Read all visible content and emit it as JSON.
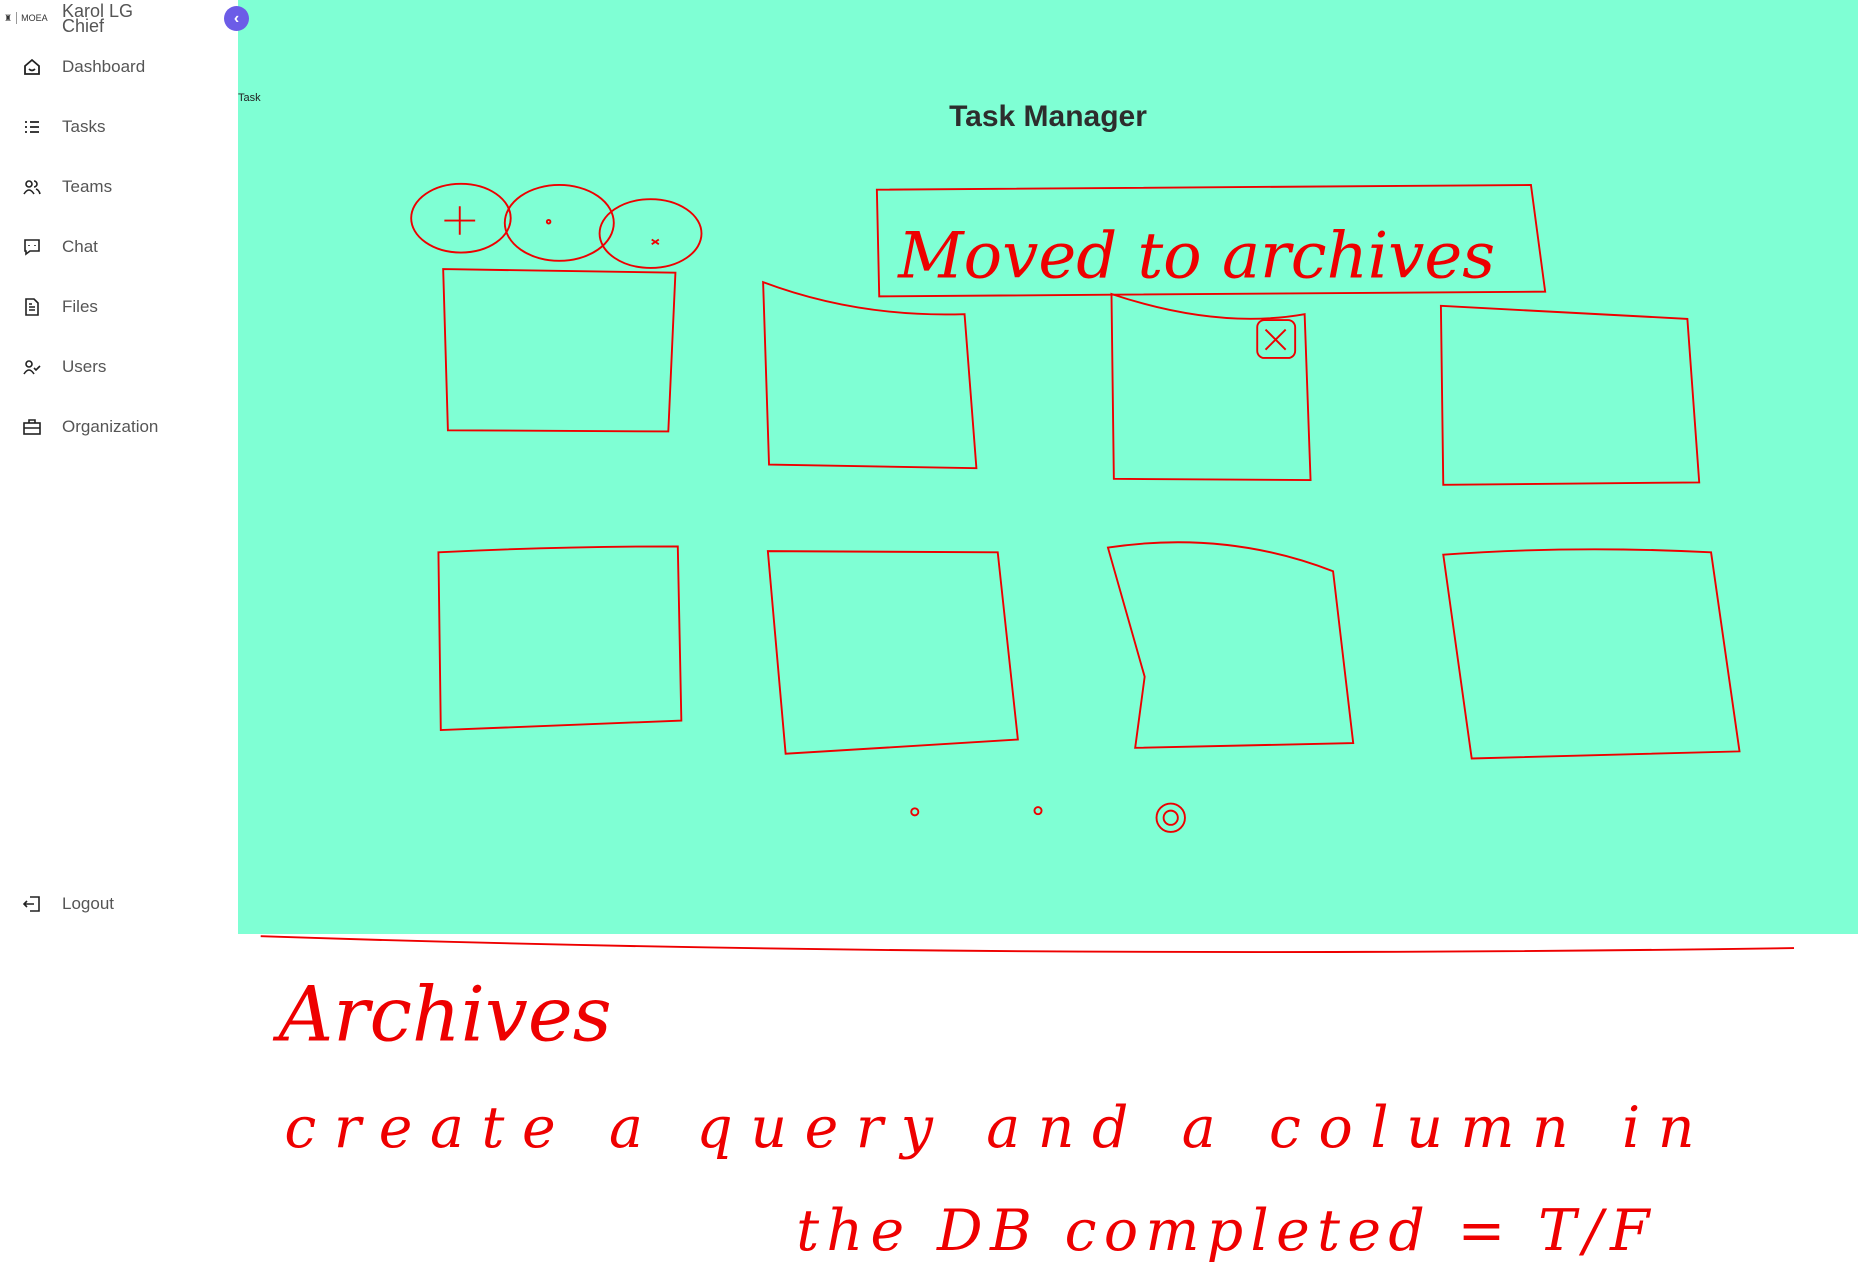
{
  "sidebar": {
    "brand": "MOEA",
    "user_name": "Karol LG",
    "user_role": "Chief",
    "collapse_icon": "chevron-left-icon",
    "items": [
      {
        "label": "Dashboard",
        "icon": "home-icon"
      },
      {
        "label": "Tasks",
        "icon": "list-icon"
      },
      {
        "label": "Teams",
        "icon": "users-icon"
      },
      {
        "label": "Chat",
        "icon": "chat-icon"
      },
      {
        "label": "Files",
        "icon": "file-icon"
      },
      {
        "label": "Users",
        "icon": "user-check-icon"
      },
      {
        "label": "Organization",
        "icon": "briefcase-icon"
      }
    ],
    "logout": "Logout"
  },
  "main": {
    "breadcrumb": "Task",
    "title": "Task Manager",
    "background": "#7fffd4"
  },
  "annotations": {
    "ink_color": "#ee0000",
    "buttons_note": [
      "+",
      "·",
      "×"
    ],
    "banner": "Moved to archives",
    "heading": "Archives",
    "note_line1": "create a query and a column in",
    "note_line2": "the DB completed = T/F"
  }
}
